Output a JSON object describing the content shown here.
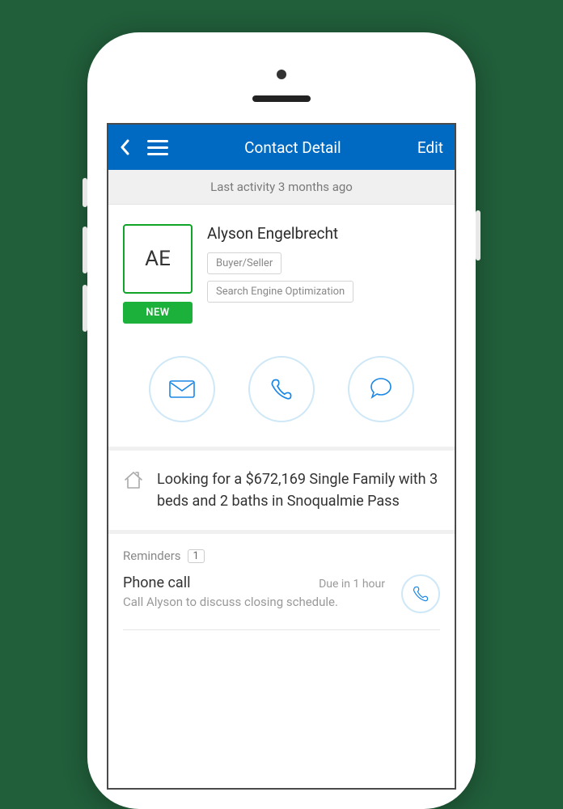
{
  "header": {
    "title": "Contact Detail",
    "edit_label": "Edit"
  },
  "activity_bar": "Last activity 3 months ago",
  "contact": {
    "initials": "AE",
    "badge": "NEW",
    "name": "Alyson Engelbrecht",
    "tags": [
      "Buyer/Seller",
      "Search Engine Optimization"
    ]
  },
  "actions": {
    "email": "email-icon",
    "call": "phone-icon",
    "chat": "chat-icon"
  },
  "looking": "Looking for a $672,169 Single Family with 3 beds and 2 baths in Snoqualmie Pass",
  "reminders": {
    "label": "Reminders",
    "count": "1",
    "items": [
      {
        "title": "Phone call",
        "due": "Due in 1 hour",
        "desc": "Call Alyson to discuss closing schedule."
      }
    ]
  }
}
